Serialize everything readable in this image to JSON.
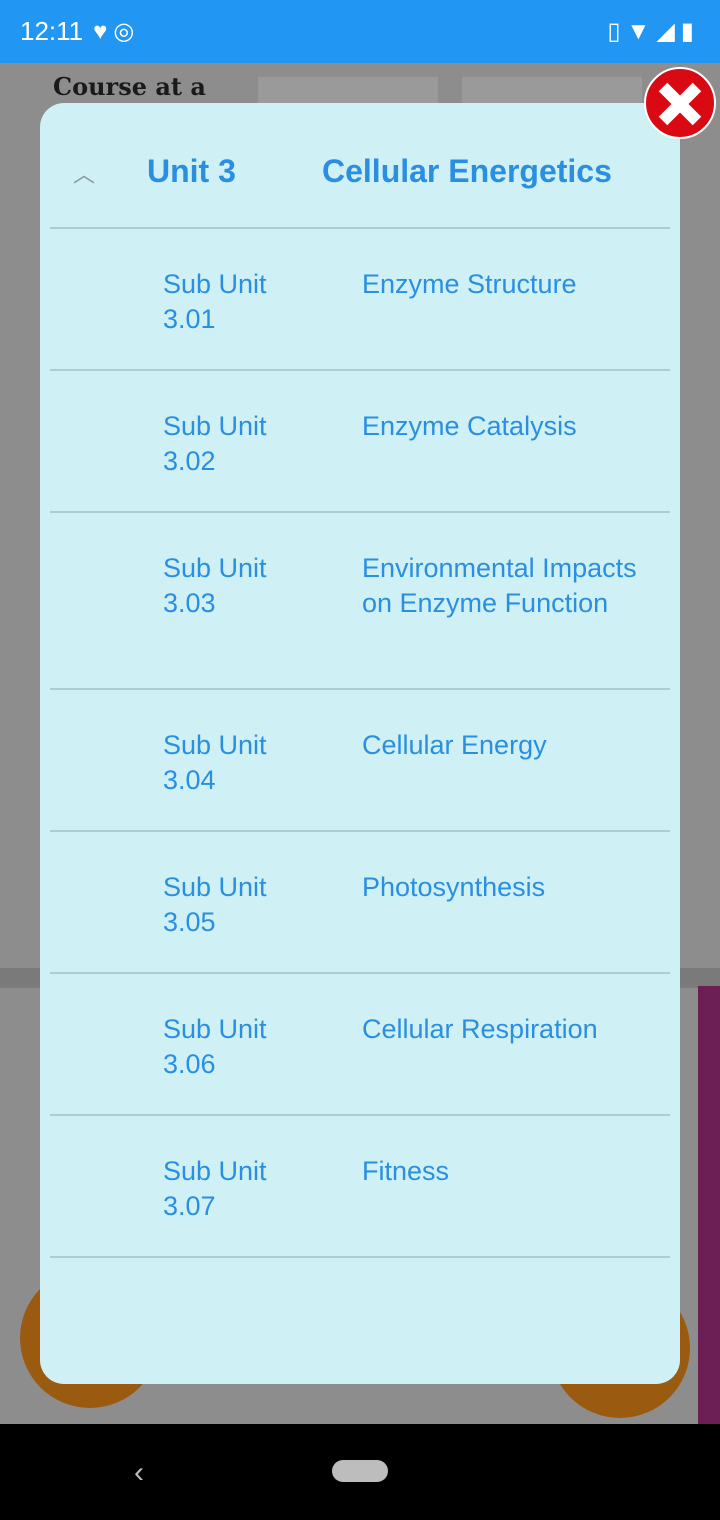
{
  "status_bar": {
    "time": "12:11",
    "left_icons": [
      "heart-icon",
      "sync-icon"
    ],
    "right_icons": [
      "vibrate-icon",
      "wifi-icon",
      "signal-icon",
      "battery-charging-icon"
    ]
  },
  "background": {
    "title": "Course at a Glance"
  },
  "modal": {
    "unit_label": "Unit 3",
    "unit_title": "Cellular Energetics",
    "rows": [
      {
        "sub": "Sub Unit 3.01",
        "name": "Enzyme Structure"
      },
      {
        "sub": "Sub Unit 3.02",
        "name": "Enzyme Catalysis"
      },
      {
        "sub": "Sub Unit 3.03",
        "name": "Environmental Impacts on Enzyme Function"
      },
      {
        "sub": "Sub Unit 3.04",
        "name": "Cellular Energy"
      },
      {
        "sub": "Sub Unit 3.05",
        "name": "Photosynthesis"
      },
      {
        "sub": "Sub Unit 3.06",
        "name": "Cellular Respiration"
      },
      {
        "sub": "Sub Unit 3.07",
        "name": "Fitness"
      }
    ]
  },
  "colors": {
    "accent": "#2196F3",
    "text": "#2a8fe0",
    "modal_bg": "#cff0f4",
    "close": "#d90a14"
  }
}
